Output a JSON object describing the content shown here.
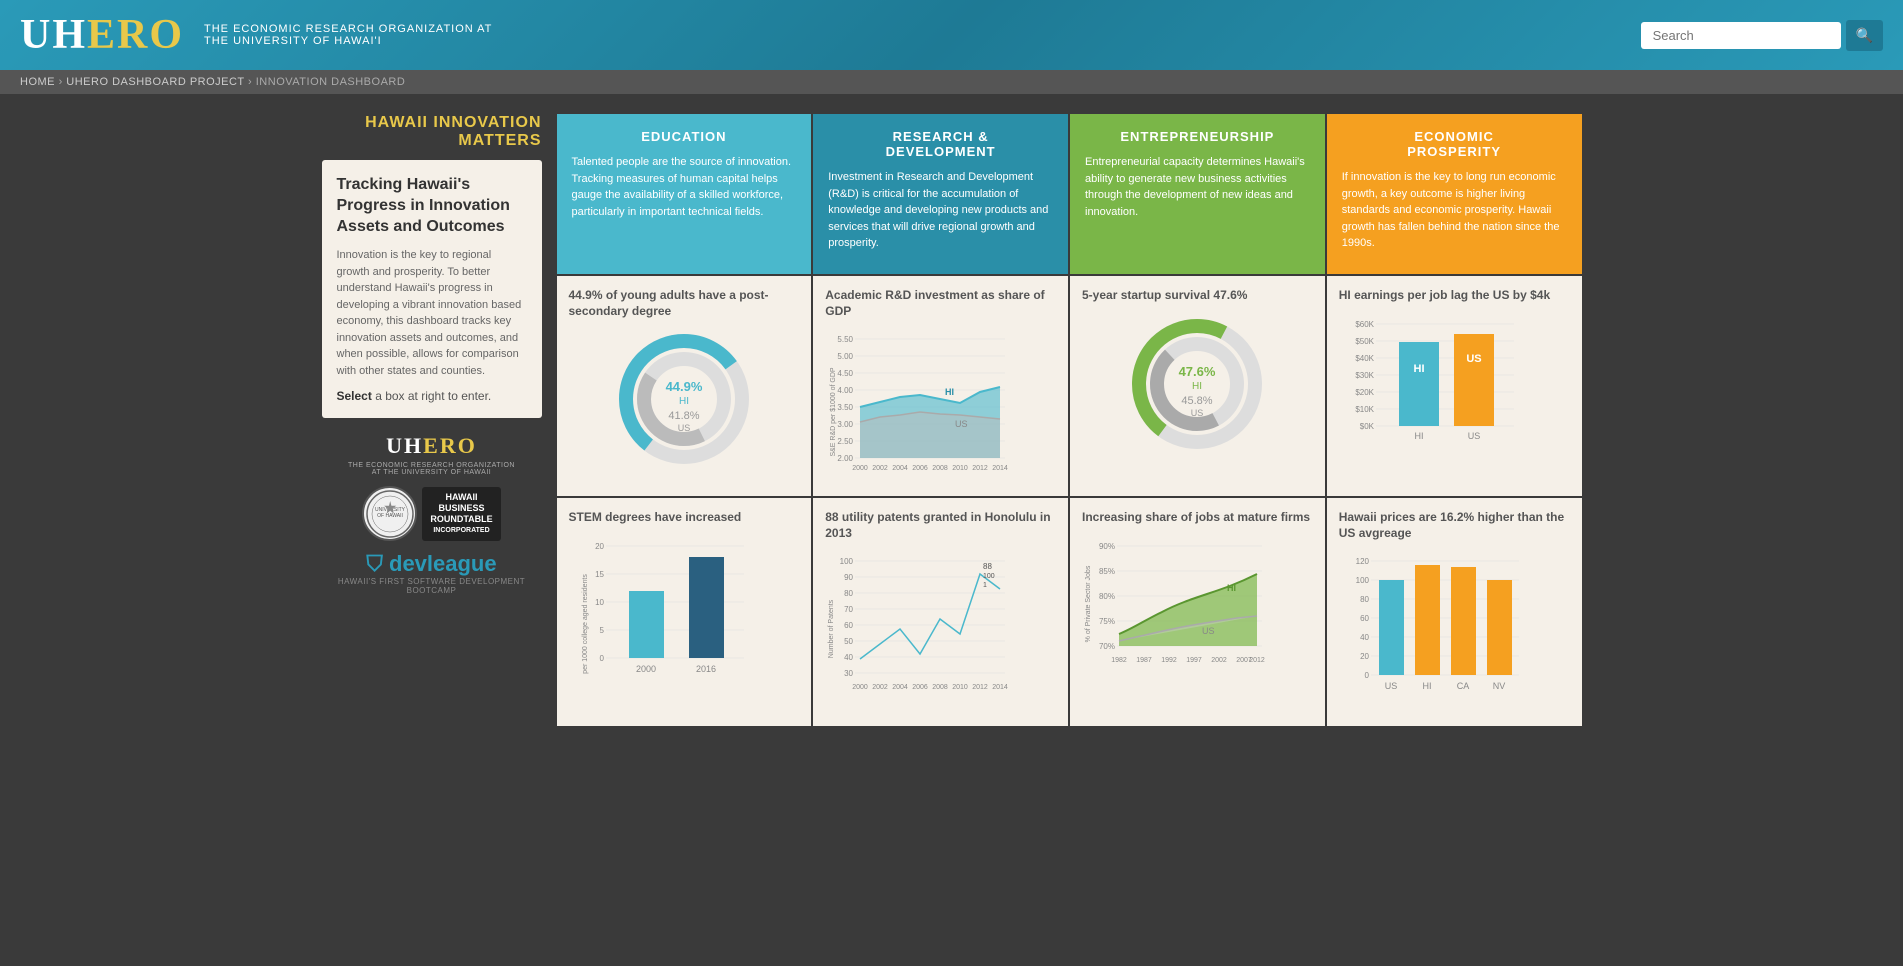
{
  "header": {
    "logo_uh": "UH",
    "logo_ero": "ERO",
    "tagline": "THE ECONOMIC RESEARCH ORGANIZATION AT THE UNIVERSITY OF HAWAI'I",
    "search_placeholder": "Search",
    "search_button_icon": "🔍"
  },
  "breadcrumb": {
    "items": [
      "HOME",
      "UHERO DASHBOARD PROJECT",
      "INNOVATION DASHBOARD"
    ]
  },
  "sidebar": {
    "title_hawaii": "HAWAII",
    "title_rest": " INNOVATION MATTERS",
    "card_heading": "Tracking Hawaii's Progress in Innovation Assets and Outcomes",
    "card_body": "Innovation is the key to regional growth and prosperity. To better understand Hawaii's progress in developing a vibrant innovation based economy, this dashboard tracks key innovation assets and outcomes, and when possible, allows for comparison with other states and counties.",
    "select_prompt": "Select a box at right to enter.",
    "uhero_logo": "UHERO",
    "uhero_tagline": "THE ECONOMIC RESEARCH ORGANIZATION AT THE UNIVERSITY OF HAWAII",
    "devleague_label": "devleague",
    "devleague_tagline": "HAWAII'S FIRST SOFTWARE DEVELOPMENT BOOTCAMP"
  },
  "categories": [
    {
      "id": "education",
      "label": "EDUCATION",
      "color": "#4ab8cc",
      "description": "Talented people are the source of innovation. Tracking measures of human capital helps gauge the availability of a skilled workforce, particularly in important technical fields."
    },
    {
      "id": "rd",
      "label": "RESEARCH & DEVELOPMENT",
      "color": "#2a8fa8",
      "description": "Investment in Research and Development (R&D) is critical for the accumulation of knowledge and developing new products and services that will drive regional growth and prosperity."
    },
    {
      "id": "entrepreneurship",
      "label": "ENTREPRENEURSHIP",
      "color": "#7ab648",
      "description": "Entrepreneurial capacity determines Hawaii's ability to generate new business activities through the development of new ideas and innovation."
    },
    {
      "id": "economic",
      "label": "ECONOMIC PROSPERITY",
      "color": "#f5a020",
      "description": "If innovation is the key to long run economic growth, a key outcome is higher living standards and economic prosperity. Hawaii growth has fallen behind the nation since the 1990s."
    }
  ],
  "data_cells": {
    "education_stat1": {
      "title": "44.9% of young adults have a post-secondary degree",
      "hi_value": "44.9%",
      "hi_label": "HI",
      "us_value": "41.8%",
      "us_label": "US",
      "hi_pct": 44.9,
      "us_pct": 41.8
    },
    "rd_stat1": {
      "title": "Academic R&D investment as share of GDP",
      "y_max": 5.5,
      "y_min": 2.0,
      "y_labels": [
        "5.50",
        "5.00",
        "4.50",
        "4.00",
        "3.50",
        "3.00",
        "2.50",
        "2.00"
      ],
      "x_labels": [
        "2000",
        "2002",
        "2004",
        "2006",
        "2008",
        "2010",
        "2012",
        "2014"
      ],
      "y_axis_label": "S&E R&D per $1000 of GDP"
    },
    "entrepreneurship_stat1": {
      "title": "5-year startup survival 47.6%",
      "hi_value": "47.6%",
      "hi_label": "HI",
      "us_value": "45.8%",
      "us_label": "US"
    },
    "economic_stat1": {
      "title": "HI earnings per job lag the US by $4k",
      "hi_bar_height": 70,
      "us_bar_height": 75,
      "hi_color": "#4ab8cc",
      "us_color": "#f5a020",
      "y_labels": [
        "$60K",
        "$50K",
        "$40K",
        "$30K",
        "$20K",
        "$10K",
        "$0K"
      ]
    },
    "education_stat2": {
      "title": "STEM degrees have increased",
      "y_labels": [
        "20",
        "15",
        "10",
        "5",
        "0"
      ],
      "x_labels": [
        "2000",
        "2016"
      ],
      "bar_2000": 55,
      "bar_2016": 90,
      "y_axis_label": "per 1000 college aged residents"
    },
    "rd_stat2": {
      "title": "88 utility patents granted in Honolulu in 2013",
      "y_labels": [
        "100",
        "90",
        "80",
        "70",
        "60",
        "50",
        "40",
        "30"
      ],
      "x_labels": [
        "2000",
        "2002",
        "2004",
        "2006",
        "2008",
        "2010",
        "2012",
        "2014"
      ],
      "y_axis_label": "Number of Patents"
    },
    "entrepreneurship_stat2": {
      "title": "Increasing share of jobs at mature firms",
      "y_labels": [
        "90%",
        "85%",
        "80%",
        "75%",
        "70%"
      ],
      "x_labels": [
        "1982",
        "1987",
        "1992",
        "1997",
        "2002",
        "2007",
        "2012"
      ],
      "y_axis_label": "% of Private Sector Jobs"
    },
    "economic_stat2": {
      "title": "Hawaii prices are 16.2% higher than the US avgreage",
      "bars": [
        {
          "label": "US",
          "value": 100,
          "color": "#4ab8cc"
        },
        {
          "label": "HI",
          "value": 116,
          "color": "#f5a020"
        },
        {
          "label": "CA",
          "value": 113,
          "color": "#f5a020"
        },
        {
          "label": "NV",
          "value": 100,
          "color": "#f5a020"
        }
      ],
      "y_labels": [
        "120",
        "100",
        "80",
        "60",
        "40",
        "20",
        "0"
      ]
    }
  }
}
